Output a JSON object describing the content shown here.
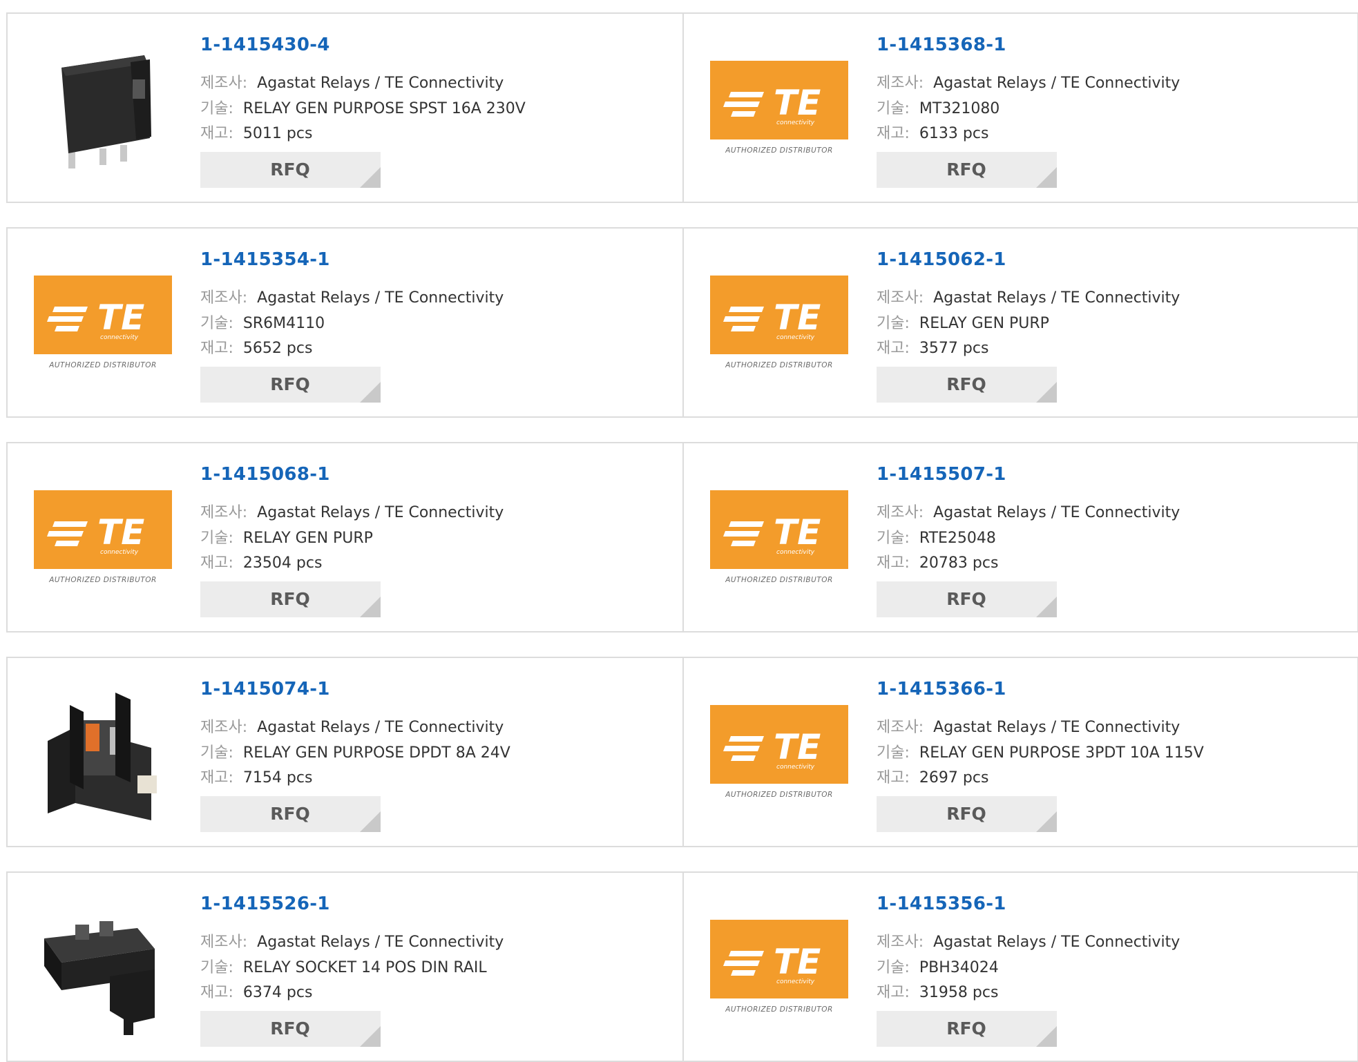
{
  "labels": {
    "manufacturer": "제조사:",
    "description": "기술:",
    "stock": "재고:",
    "rfq": "RFQ"
  },
  "te_logo": {
    "brand": "TE",
    "sub_brand": "connectivity",
    "caption": "AUTHORIZED DISTRIBUTOR",
    "color": "#f39c2b"
  },
  "products": [
    {
      "part": "1-1415430-4",
      "manufacturer": "Agastat Relays / TE Connectivity",
      "description": "RELAY GEN PURPOSE SPST 16A 230V",
      "stock": "5011 pcs",
      "image": "relay-icon"
    },
    {
      "part": "1-1415368-1",
      "manufacturer": "Agastat Relays / TE Connectivity",
      "description": "MT321080",
      "stock": "6133 pcs",
      "image": "te-logo"
    },
    {
      "part": "1-1415354-1",
      "manufacturer": "Agastat Relays / TE Connectivity",
      "description": "SR6M4110",
      "stock": "5652 pcs",
      "image": "te-logo"
    },
    {
      "part": "1-1415062-1",
      "manufacturer": "Agastat Relays / TE Connectivity",
      "description": "RELAY GEN PURP",
      "stock": "3577 pcs",
      "image": "te-logo"
    },
    {
      "part": "1-1415068-1",
      "manufacturer": "Agastat Relays / TE Connectivity",
      "description": "RELAY GEN PURP",
      "stock": "23504 pcs",
      "image": "te-logo"
    },
    {
      "part": "1-1415507-1",
      "manufacturer": "Agastat Relays / TE Connectivity",
      "description": "RTE25048",
      "stock": "20783 pcs",
      "image": "te-logo"
    },
    {
      "part": "1-1415074-1",
      "manufacturer": "Agastat Relays / TE Connectivity",
      "description": "RELAY GEN PURPOSE DPDT 8A 24V",
      "stock": "7154 pcs",
      "image": "relay-socket-icon"
    },
    {
      "part": "1-1415366-1",
      "manufacturer": "Agastat Relays / TE Connectivity",
      "description": "RELAY GEN PURPOSE 3PDT 10A 115V",
      "stock": "2697 pcs",
      "image": "te-logo"
    },
    {
      "part": "1-1415526-1",
      "manufacturer": "Agastat Relays / TE Connectivity",
      "description": "RELAY SOCKET 14 POS DIN RAIL",
      "stock": "6374 pcs",
      "image": "din-socket-icon"
    },
    {
      "part": "1-1415356-1",
      "manufacturer": "Agastat Relays / TE Connectivity",
      "description": "PBH34024",
      "stock": "31958 pcs",
      "image": "te-logo"
    }
  ]
}
